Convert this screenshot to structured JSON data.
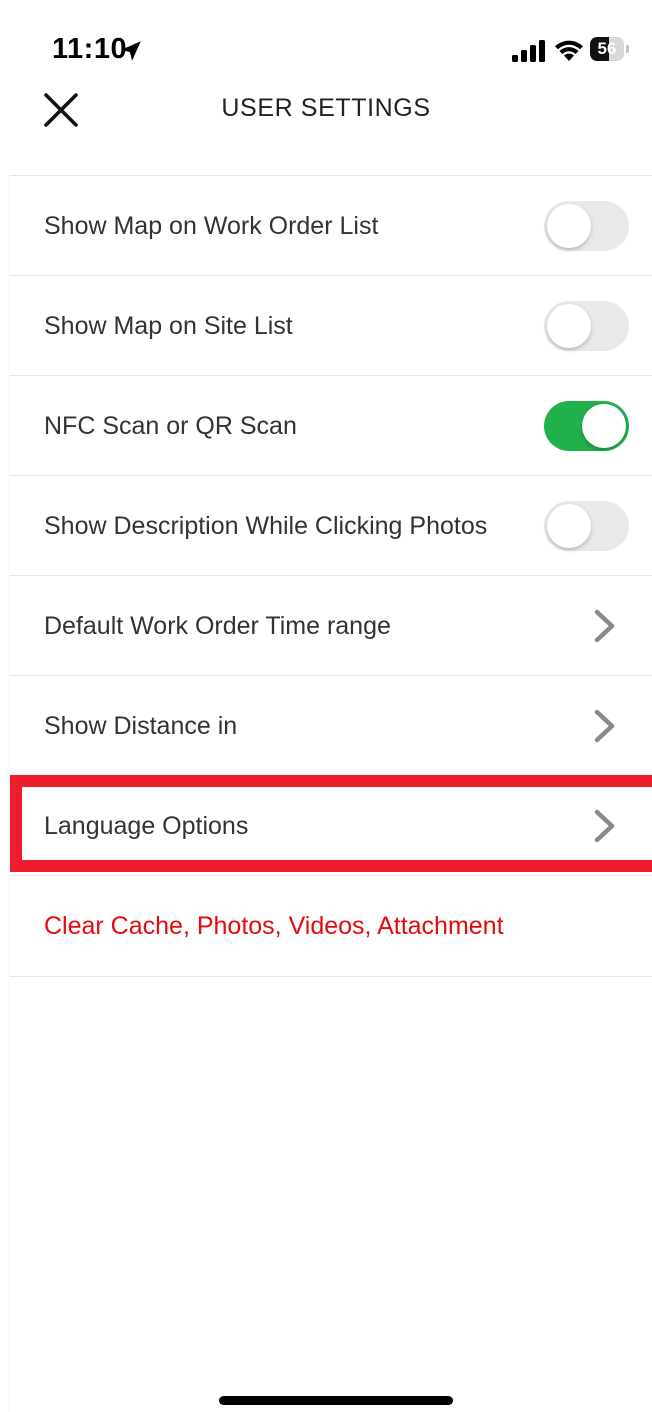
{
  "status_bar": {
    "time": "11:10",
    "battery_level": "56",
    "battery_fraction": 0.56
  },
  "header": {
    "title": "USER SETTINGS",
    "close_icon": "close-icon"
  },
  "settings": [
    {
      "label": "Show Map on Work Order List",
      "control": "toggle",
      "on": false
    },
    {
      "label": "Show Map on Site List",
      "control": "toggle",
      "on": false
    },
    {
      "label": "NFC Scan or QR Scan",
      "control": "toggle",
      "on": true
    },
    {
      "label": "Show Description While Clicking Photos",
      "control": "toggle",
      "on": false
    },
    {
      "label": "Default Work Order Time range",
      "control": "chevron"
    },
    {
      "label": "Show Distance in",
      "control": "chevron"
    },
    {
      "label": "Language Options",
      "control": "chevron",
      "highlighted": true
    },
    {
      "label": "Clear Cache, Photos, Videos, Attachment",
      "control": "none",
      "danger": true
    }
  ],
  "colors": {
    "toggle_on": "#20b04c",
    "toggle_off": "#e9e9ea",
    "highlight": "#ee1c2c",
    "danger_text": "#e30b0b"
  }
}
